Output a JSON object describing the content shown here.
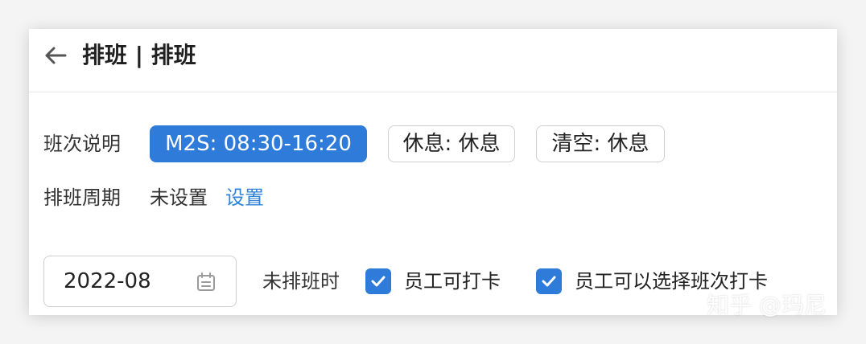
{
  "header": {
    "title": "排班 | 排班"
  },
  "shift_section": {
    "label": "班次说明",
    "shifts": [
      {
        "label": "M2S: 08:30-16:20",
        "selected": true
      },
      {
        "label": "休息: 休息",
        "selected": false
      },
      {
        "label": "清空: 休息",
        "selected": false
      }
    ]
  },
  "cycle_section": {
    "label": "排班周期",
    "value": "未设置",
    "link": "设置"
  },
  "filter_row": {
    "month_value": "2022-08",
    "unscheduled_label": "未排班时",
    "options": [
      {
        "label": "员工可打卡",
        "checked": true
      },
      {
        "label": "员工可以选择班次打卡",
        "checked": true
      }
    ]
  },
  "watermark": "知乎 @玛尼",
  "colors": {
    "primary": "#2f7bd9",
    "link": "#2f83d9",
    "border": "#cfcfcf"
  },
  "icons": [
    "back-arrow-icon",
    "calendar-icon",
    "checkmark-icon"
  ]
}
